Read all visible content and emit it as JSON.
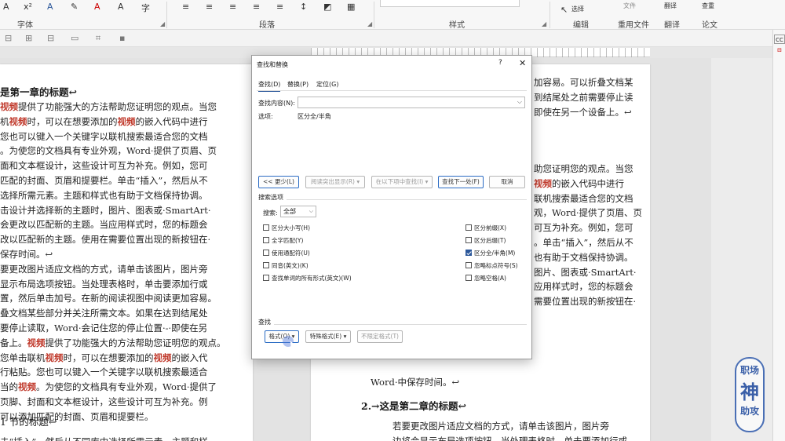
{
  "ribbon": {
    "groups": {
      "font": "字体",
      "paragraph": "段落",
      "styles": "样式",
      "editing": "编辑",
      "reuse": "重用文件",
      "translate": "翻译",
      "paper": "论文"
    },
    "top_labels": {
      "file": "文件",
      "translate": "翻译",
      "check": "查重",
      "select": "选择"
    }
  },
  "document": {
    "left_heading": "是第一章的标题↩",
    "left_lines": [
      [
        "",
        "视频",
        "提供了功能强大的方法帮助您证明您的观点。当您"
      ],
      [
        "机",
        "视频",
        "时，可以在想要添加的",
        "视频",
        "的嵌入代码中进行"
      ],
      [
        "您也可以键入一个关键字以联机搜索最适合您的文档"
      ],
      [
        "。为使您的文档具有专业外观，Word·提供了页眉、页"
      ],
      [
        "面和文本框设计，这些设计可互为补充。例如，您可"
      ],
      [
        "匹配的封面、页眉和提要栏。单击“插入”，然后从不"
      ],
      [
        "选择所需元素。主题和样式也有助于文档保持协调。"
      ],
      [
        "击设计并选择新的主题时，图片、图表或·SmartArt·"
      ],
      [
        "会更改以匹配新的主题。当应用样式时，您的标题会"
      ],
      [
        "改以匹配新的主题。使用在需要位置出现的新按钮在·"
      ],
      [
        "保存时间。↩"
      ],
      [
        "要更改图片适应文档的方式，请单击该图片，图片旁"
      ],
      [
        "显示布局选项按钮。当处理表格时，单击要添加行或"
      ],
      [
        "置，然后单击加号。在新的阅读视图中阅读更加容易。"
      ],
      [
        "叠文档某些部分并关注所需文本。如果在达到结尾处"
      ],
      [
        "要停止读取，Word·会记住您的停止位置·-·即使在另"
      ],
      [
        "备上。",
        "视频",
        "提供了功能强大的方法帮助您证明您的观点。"
      ],
      [
        "您单击联机",
        "视频",
        "时，可以在想要添加的",
        "视频",
        "的嵌入代"
      ],
      [
        "行粘贴。您也可以键入一个关键字以联机搜索最适合"
      ],
      [
        "当的",
        "视频",
        "。为使您的文档具有专业外观，Word·提供了"
      ],
      [
        "页脚、封面和文本框设计，这些设计可互为补充。例"
      ],
      [
        "可以添加匹配的封面、页眉和提要栏。"
      ]
    ],
    "left_subheading": "1 节的标题↩",
    "left_last_line": "击“插入”，然后从不同库中选择所需元素。主题和样",
    "right_top_lines": [
      "加容易。可以折叠文档某",
      "到结尾处之前需要停止读",
      "即使在另一个设备上。↩"
    ],
    "right_lines": [
      [
        "助您证明您的观点。当您"
      ],
      [
        "",
        "视频",
        "的嵌入代码中进行"
      ],
      [
        "联机搜索最适合您的文档"
      ],
      [
        "观，Word·提供了页眉、页"
      ],
      [
        "可互为补充。例如，您可"
      ],
      [
        "。单击“插入”，然后从不"
      ],
      [
        "也有助于文档保持协调。"
      ],
      [
        "图片、图表或·SmartArt·"
      ],
      [
        "应用样式时，您的标题会"
      ],
      [
        "需要位置出现的新按钮在·"
      ]
    ],
    "right_word_line": "Word·中保存时间。↩",
    "right_heading": "2.→这是第二章的标题↩",
    "right_bottom_lines": [
      "若要更改图片适应文档的方式，请单击该图片，图片旁",
      "边将会显示布局选项按钮。当处理表格时，单击要添加行或"
    ]
  },
  "dialog": {
    "title": "查找和替换",
    "help": "?",
    "close": "✕",
    "tabs": [
      "查找(D)",
      "替换(P)",
      "定位(G)"
    ],
    "find_label": "查找内容(N):",
    "find_value": "",
    "options_label": "选项:",
    "options_value": "区分全/半角",
    "buttons": {
      "less": "<< 更少(L)",
      "reading_highlight": "阅读突出显示(R) ▾",
      "find_in": "在以下项中查找(I) ▾",
      "find_next": "查找下一处(F)",
      "cancel": "取消"
    },
    "search_options_title": "搜索选项",
    "search_label": "搜索:",
    "search_value": "全部",
    "left_checks": [
      {
        "label": "区分大小写(H)",
        "checked": false
      },
      {
        "label": "全字匹配(Y)",
        "checked": false
      },
      {
        "label": "使用通配符(U)",
        "checked": false
      },
      {
        "label": "同音(英文)(K)",
        "checked": false
      },
      {
        "label": "查找单词的所有形式(英文)(W)",
        "checked": false
      }
    ],
    "right_checks": [
      {
        "label": "区分前缀(X)",
        "checked": false
      },
      {
        "label": "区分后缀(T)",
        "checked": false
      },
      {
        "label": "区分全/半角(M)",
        "checked": true
      },
      {
        "label": "忽略标点符号(S)",
        "checked": false
      },
      {
        "label": "忽略空格(A)",
        "checked": false
      }
    ],
    "find_section_title": "查找",
    "bottom_buttons": {
      "format": "格式(O) ▾",
      "special": "特殊格式(E) ▾",
      "no_format": "不限定格式(T)"
    }
  },
  "logo": {
    "line1": "职场",
    "line2": "神",
    "line3": "助攻"
  },
  "colors": {
    "accent": "#2b579a",
    "highlight": "#c0392b",
    "logo": "#3a5fa8"
  }
}
